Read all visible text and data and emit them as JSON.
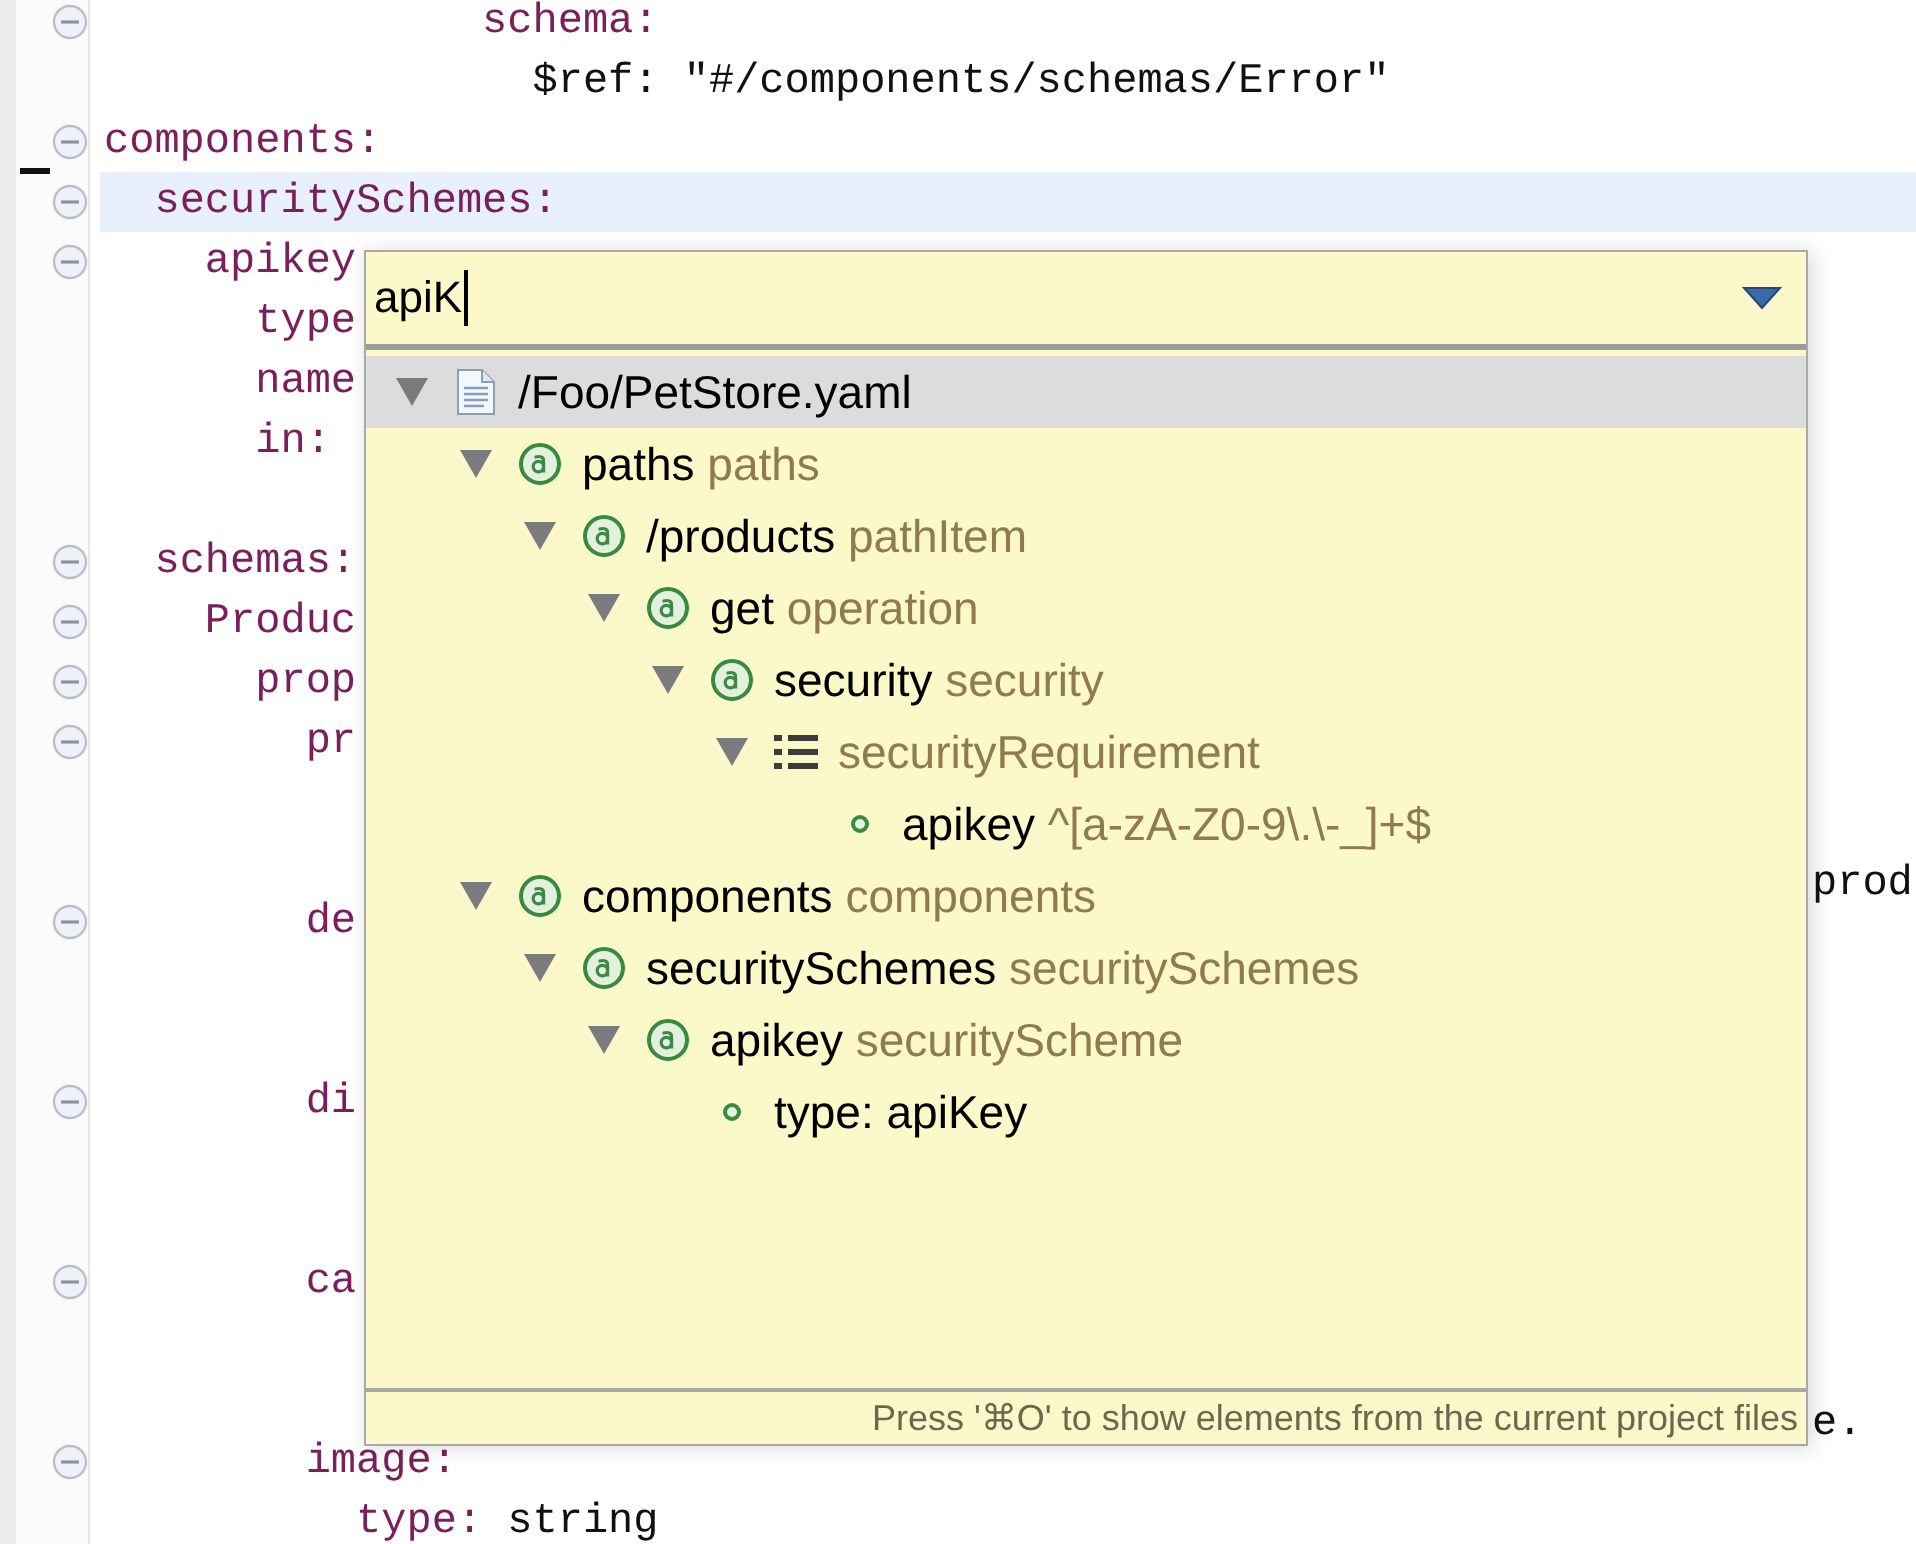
{
  "editor": {
    "lines": [
      {
        "kind": "code",
        "key": "               schema:",
        "expanded": true
      },
      {
        "kind": "code",
        "value": "                 $ref: \"#/components/schemas/Error\""
      },
      {
        "kind": "code",
        "key": "components:",
        "expanded": true
      },
      {
        "kind": "code",
        "key": "  securitySchemes:",
        "expanded": true,
        "current": true
      },
      {
        "kind": "code",
        "key": "    apikey",
        "expanded": true
      },
      {
        "kind": "code",
        "key": "      type"
      },
      {
        "kind": "code",
        "key": "      name"
      },
      {
        "kind": "code",
        "key": "      in:"
      },
      {
        "kind": "blank"
      },
      {
        "kind": "code",
        "key": "  schemas:",
        "expanded": true
      },
      {
        "kind": "code",
        "key": "    Produc",
        "expanded": true
      },
      {
        "kind": "code",
        "key": "      prop",
        "expanded": true
      },
      {
        "kind": "code",
        "key": "        pr",
        "expanded": true
      },
      {
        "kind": "blank"
      },
      {
        "kind": "code",
        "tail": "prod"
      },
      {
        "kind": "code",
        "key": "        de",
        "expanded": true
      },
      {
        "kind": "blank"
      },
      {
        "kind": "blank"
      },
      {
        "kind": "code",
        "key": "        di",
        "expanded": true
      },
      {
        "kind": "blank"
      },
      {
        "kind": "blank"
      },
      {
        "kind": "code",
        "key": "        ca",
        "expanded": true
      },
      {
        "kind": "blank"
      },
      {
        "kind": "code",
        "tail": "e."
      },
      {
        "kind": "code",
        "key": "        image:",
        "expanded": true
      },
      {
        "kind": "code",
        "key": "          type:",
        "value": " string"
      }
    ]
  },
  "popup": {
    "filter": "apiK",
    "tree": [
      {
        "kind": "file",
        "name": "/Foo/PetStore.yaml",
        "expanded": true,
        "selected": true,
        "children": [
          {
            "kind": "object",
            "name": "paths",
            "type": "paths",
            "expanded": true,
            "selected": false,
            "children": [
              {
                "kind": "object",
                "name": "/products",
                "type": "pathItem",
                "expanded": true,
                "selected": false,
                "children": [
                  {
                    "kind": "object",
                    "name": "get",
                    "type": "operation",
                    "expanded": true,
                    "selected": false,
                    "children": [
                      {
                        "kind": "object",
                        "name": "security",
                        "type": "security",
                        "expanded": true,
                        "selected": false,
                        "children": [
                          {
                            "kind": "array",
                            "type": "securityRequirement",
                            "expanded": true,
                            "selected": false,
                            "children": [
                              {
                                "kind": "leaf",
                                "name": "apikey",
                                "type": "^[a-zA-Z0-9\\.\\-_]+$",
                                "selected": false
                              }
                            ]
                          }
                        ]
                      }
                    ]
                  }
                ]
              }
            ]
          },
          {
            "kind": "object",
            "name": "components",
            "type": "components",
            "expanded": true,
            "selected": false,
            "children": [
              {
                "kind": "object",
                "name": "securitySchemes",
                "type": "securitySchemes",
                "expanded": true,
                "selected": false,
                "children": [
                  {
                    "kind": "object",
                    "name": "apikey",
                    "type": "securityScheme",
                    "expanded": true,
                    "selected": false,
                    "children": [
                      {
                        "kind": "leaf",
                        "name": "type: apiKey",
                        "selected": false
                      }
                    ]
                  }
                ]
              }
            ]
          }
        ]
      }
    ],
    "hint": "Press '⌘O' to show elements from the current project files"
  }
}
